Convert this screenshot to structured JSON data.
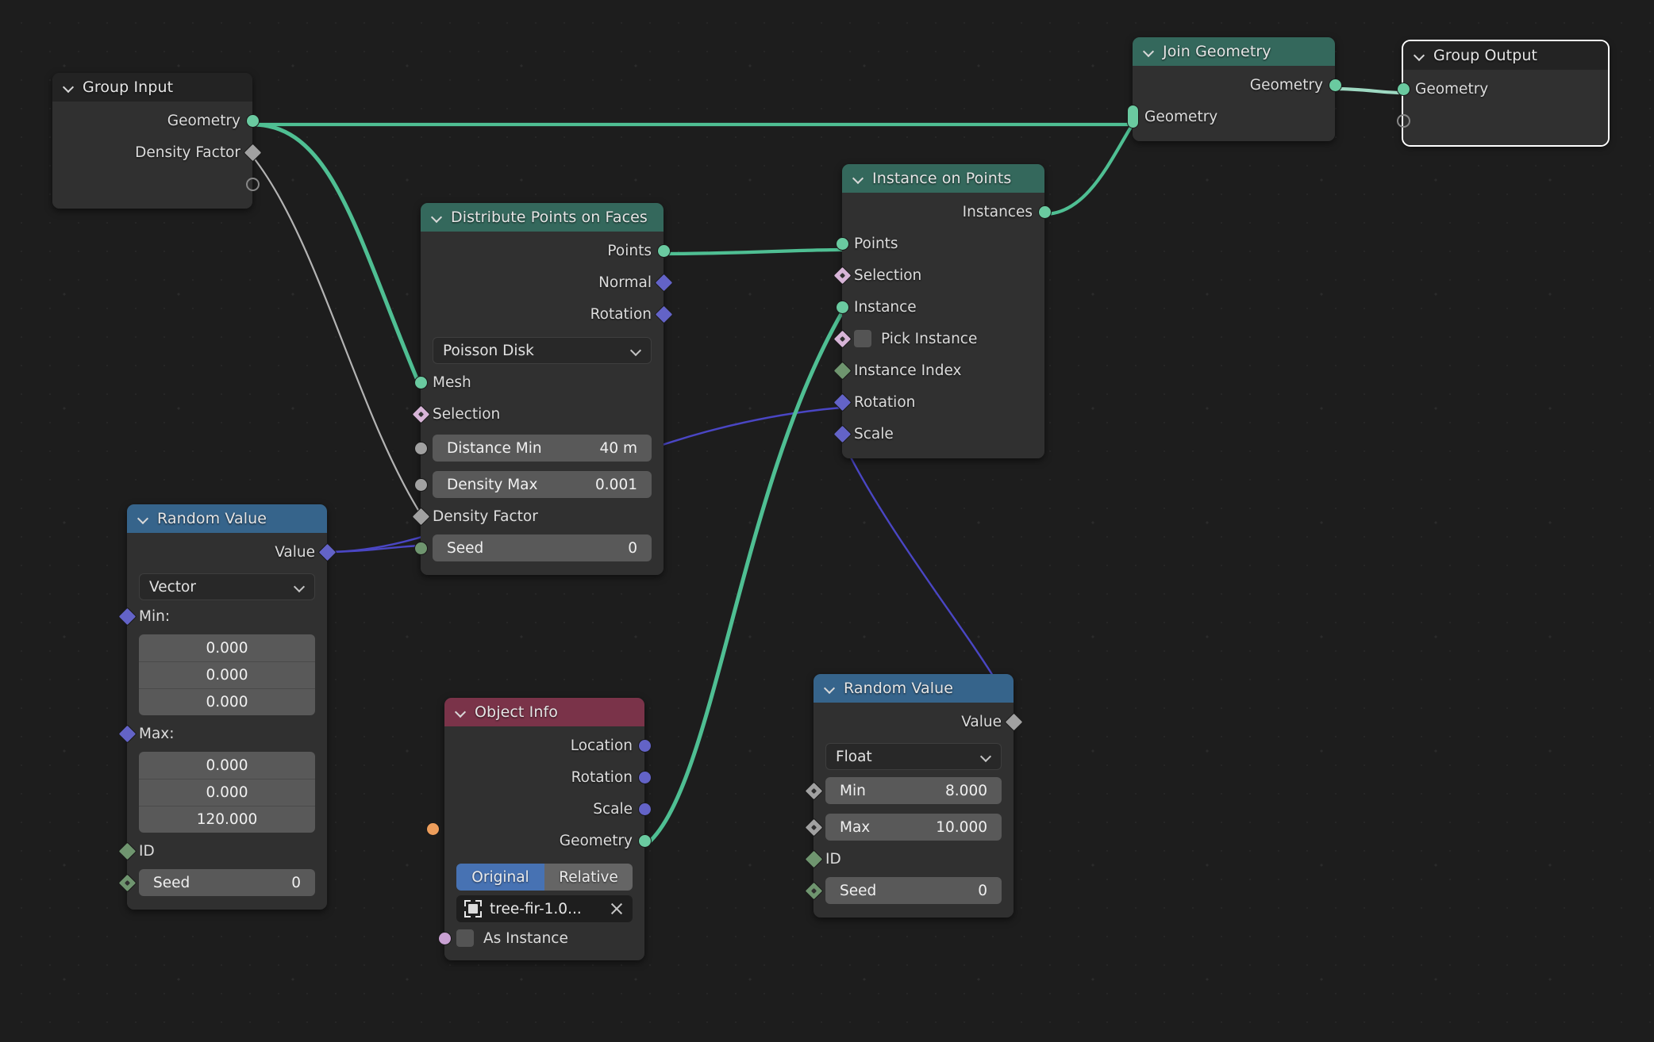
{
  "editor": {
    "name": "Blender Geometry Node Editor",
    "background_color": "#1d1d1d",
    "grid": "dot-grid"
  },
  "colors": {
    "header_geometry": "#34685c",
    "header_input": "#232323",
    "header_vector": "#36648b",
    "header_object": "#7a3349",
    "node_body": "#303030",
    "socket_geometry": "#6acaa0",
    "socket_field": "#d7b4d7",
    "socket_vector": "#6363c7",
    "socket_integer": "#6f956f",
    "socket_gray": "#a1a1a1",
    "socket_object": "#ed9e5c",
    "socket_collection": "#c9a1d3",
    "wire_geometry": "#4fbf93",
    "wire_gray": "#b4b4b4",
    "wire_vector": "#4a46c4",
    "toggle_active": "#4772b3"
  },
  "nodes": {
    "group_input": {
      "title": "Group Input",
      "outputs": [
        {
          "label": "Geometry",
          "socket": "geometry",
          "shape": "circle"
        },
        {
          "label": "Density Factor",
          "socket": "gray",
          "shape": "diamond"
        },
        {
          "label": "",
          "socket": "hollow",
          "shape": "hollow"
        }
      ]
    },
    "distribute_points": {
      "title": "Distribute Points on Faces",
      "outputs": [
        {
          "label": "Points",
          "socket": "geometry",
          "shape": "circle"
        },
        {
          "label": "Normal",
          "socket": "vector",
          "shape": "diamond"
        },
        {
          "label": "Rotation",
          "socket": "vector",
          "shape": "diamond"
        }
      ],
      "method_dropdown": "Poisson Disk",
      "inputs": [
        {
          "label": "Mesh",
          "socket": "geometry",
          "shape": "circle"
        },
        {
          "label": "Selection",
          "socket": "field",
          "shape": "diamond-dot"
        },
        {
          "label": "Distance Min",
          "value": "40 m",
          "socket": "gray",
          "shape": "circle"
        },
        {
          "label": "Density Max",
          "value": "0.001",
          "socket": "gray",
          "shape": "circle"
        },
        {
          "label": "Density Factor",
          "socket": "gray",
          "shape": "diamond"
        },
        {
          "label": "Seed",
          "value": "0",
          "socket": "integer",
          "shape": "circle"
        }
      ]
    },
    "instance_on_points": {
      "title": "Instance on Points",
      "outputs": [
        {
          "label": "Instances",
          "socket": "geometry",
          "shape": "circle"
        }
      ],
      "inputs": [
        {
          "label": "Points",
          "socket": "geometry",
          "shape": "circle"
        },
        {
          "label": "Selection",
          "socket": "field",
          "shape": "diamond-dot"
        },
        {
          "label": "Instance",
          "socket": "geometry",
          "shape": "circle"
        },
        {
          "label": "Pick Instance",
          "socket": "field",
          "shape": "diamond-dot",
          "checkbox": false
        },
        {
          "label": "Instance Index",
          "socket": "integer",
          "shape": "diamond"
        },
        {
          "label": "Rotation",
          "socket": "vector",
          "shape": "diamond"
        },
        {
          "label": "Scale",
          "socket": "vector",
          "shape": "diamond"
        }
      ]
    },
    "join_geometry": {
      "title": "Join Geometry",
      "outputs": [
        {
          "label": "Geometry",
          "socket": "geometry",
          "shape": "circle"
        }
      ],
      "inputs": [
        {
          "label": "Geometry",
          "socket": "geometry",
          "shape": "multi"
        }
      ]
    },
    "group_output": {
      "title": "Group Output",
      "selected": true,
      "inputs": [
        {
          "label": "Geometry",
          "socket": "geometry",
          "shape": "circle"
        },
        {
          "label": "",
          "socket": "hollow",
          "shape": "hollow"
        }
      ]
    },
    "random_value_vector": {
      "title": "Random Value",
      "outputs": [
        {
          "label": "Value",
          "socket": "vector",
          "shape": "diamond"
        }
      ],
      "data_type": "Vector",
      "min_label": "Min:",
      "min_values": [
        "0.000",
        "0.000",
        "0.000"
      ],
      "max_label": "Max:",
      "max_values": [
        "0.000",
        "0.000",
        "120.000"
      ],
      "id_label": "ID",
      "seed_label": "Seed",
      "seed_value": "0"
    },
    "random_value_float": {
      "title": "Random Value",
      "outputs": [
        {
          "label": "Value",
          "socket": "gray",
          "shape": "diamond"
        }
      ],
      "data_type": "Float",
      "min_label": "Min",
      "min_value": "8.000",
      "max_label": "Max",
      "max_value": "10.000",
      "id_label": "ID",
      "seed_label": "Seed",
      "seed_value": "0"
    },
    "object_info": {
      "title": "Object Info",
      "outputs": [
        {
          "label": "Location",
          "socket": "vector",
          "shape": "circle"
        },
        {
          "label": "Rotation",
          "socket": "vector",
          "shape": "circle"
        },
        {
          "label": "Scale",
          "socket": "vector",
          "shape": "circle"
        },
        {
          "label": "Geometry",
          "socket": "geometry",
          "shape": "circle"
        }
      ],
      "transform_space": {
        "option_a": "Original",
        "option_b": "Relative",
        "selected": "Original"
      },
      "object_field": {
        "value": "tree-fir-1.0...",
        "clear_label": "×"
      },
      "as_instance_label": "As Instance",
      "as_instance_checked": false
    }
  }
}
